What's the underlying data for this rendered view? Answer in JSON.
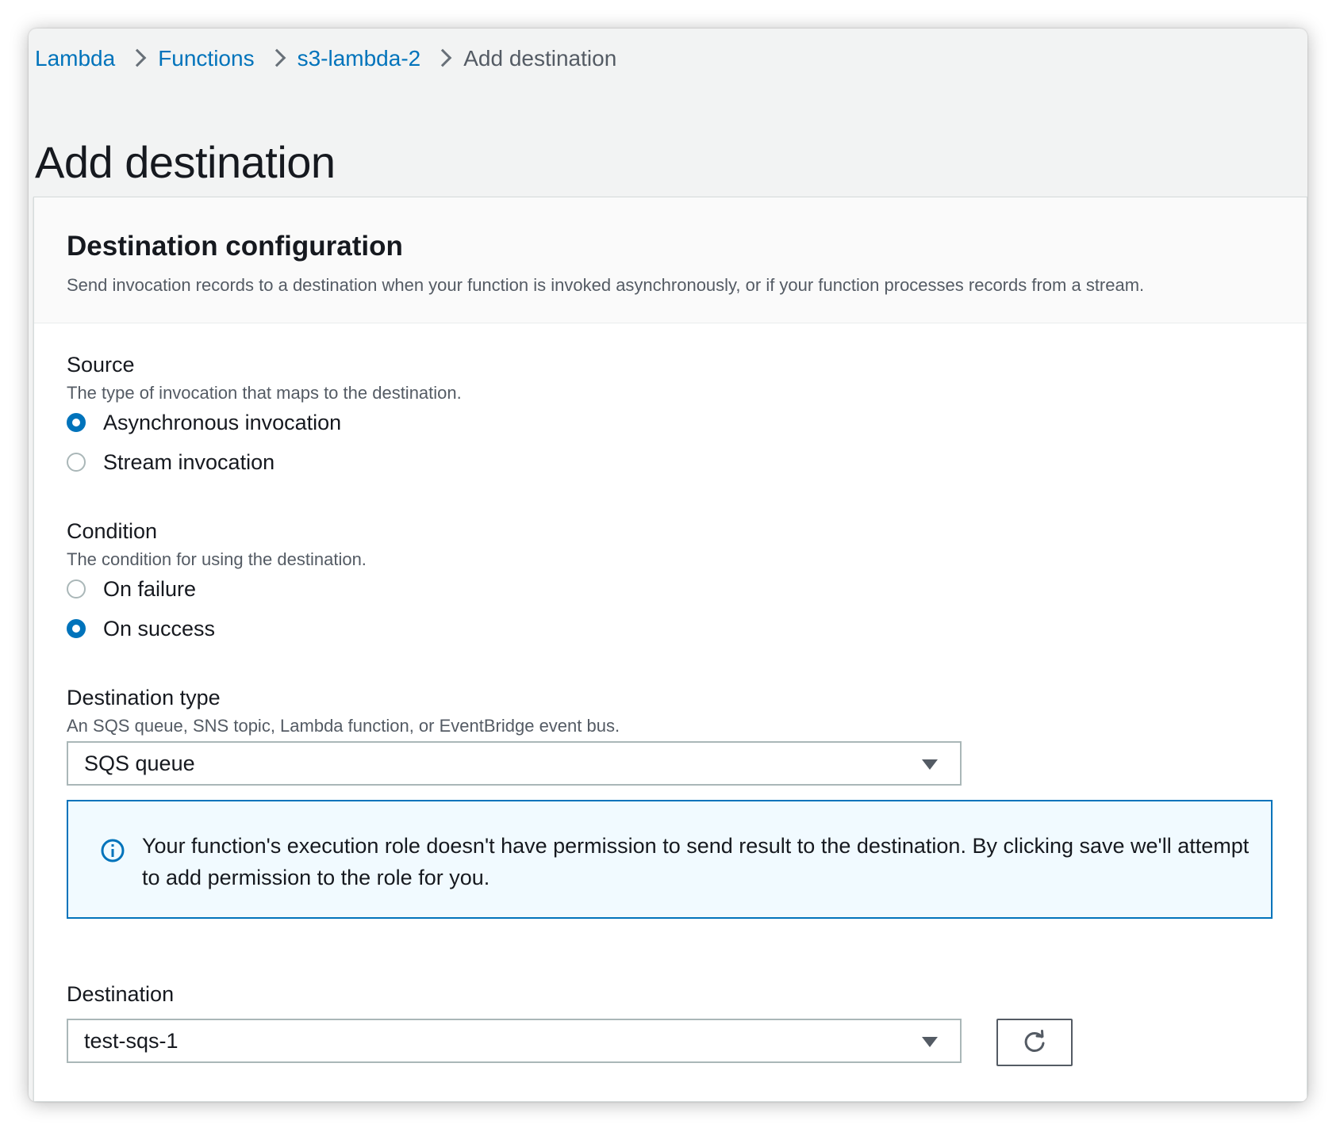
{
  "breadcrumb": {
    "items": [
      {
        "label": "Lambda"
      },
      {
        "label": "Functions"
      },
      {
        "label": "s3-lambda-2"
      },
      {
        "label": "Add destination"
      }
    ]
  },
  "page_title": "Add destination",
  "panel": {
    "title": "Destination configuration",
    "description": "Send invocation records to a destination when your function is invoked asynchronously, or if your function processes records from a stream."
  },
  "source": {
    "label": "Source",
    "description": "The type of invocation that maps to the destination.",
    "options": [
      {
        "label": "Asynchronous invocation",
        "checked": true
      },
      {
        "label": "Stream invocation",
        "checked": false
      }
    ]
  },
  "condition": {
    "label": "Condition",
    "description": "The condition for using the destination.",
    "options": [
      {
        "label": "On failure",
        "checked": false
      },
      {
        "label": "On success",
        "checked": true
      }
    ]
  },
  "destination_type": {
    "label": "Destination type",
    "description": "An SQS queue, SNS topic, Lambda function, or EventBridge event bus.",
    "value": "SQS queue"
  },
  "alert": {
    "icon": "info-icon",
    "text": "Your function's execution role doesn't have permission to send result to the destination. By clicking save we'll attempt to add permission to the role for you."
  },
  "destination": {
    "label": "Destination",
    "value": "test-sqs-1",
    "refresh_icon": "refresh-icon"
  },
  "colors": {
    "link": "#0073bb",
    "radio_selected": "#0073bb",
    "alert_border": "#0073bb",
    "alert_bg": "#f1faff"
  }
}
